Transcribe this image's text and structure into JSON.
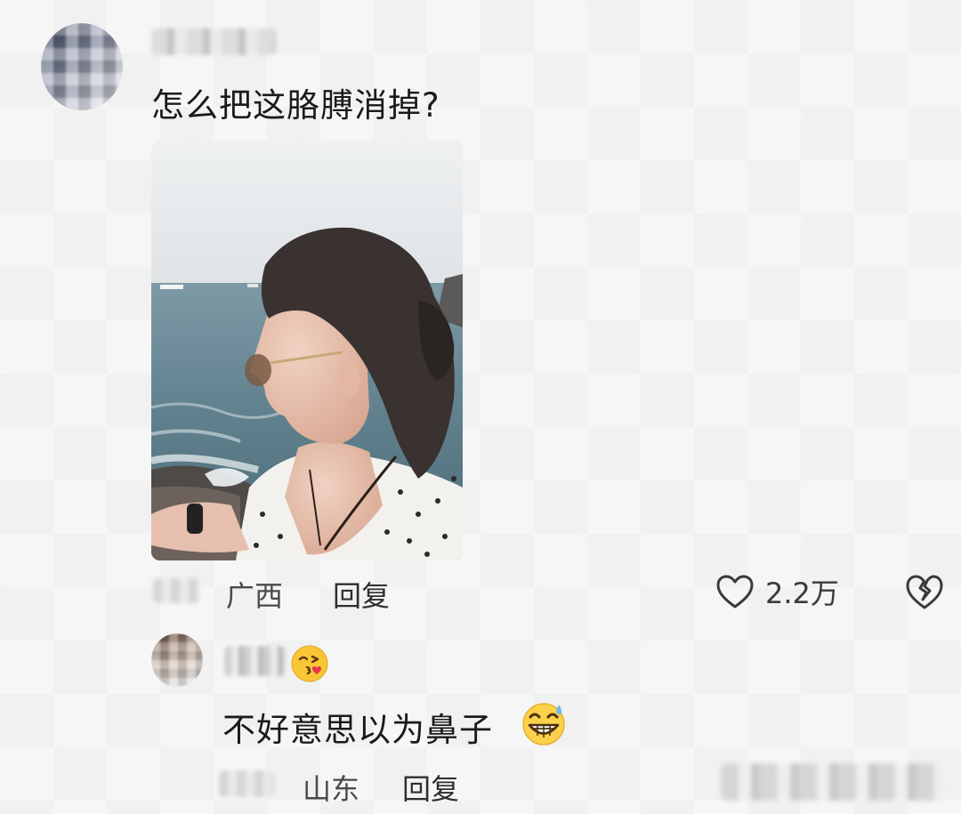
{
  "comment": {
    "question": "怎么把这胳膊消掉?",
    "location": "广西",
    "reply_label": "回复",
    "like_count": "2.2万",
    "icons": {
      "like": "heart-outline-icon",
      "dislike": "broken-heart-icon"
    }
  },
  "reply": {
    "text": "不好意思以为鼻子",
    "location": "山东",
    "reply_label": "回复",
    "icons": {
      "after_username": "face-blowing-kiss-emoji",
      "after_text": "grinning-sweat-emoji"
    }
  }
}
